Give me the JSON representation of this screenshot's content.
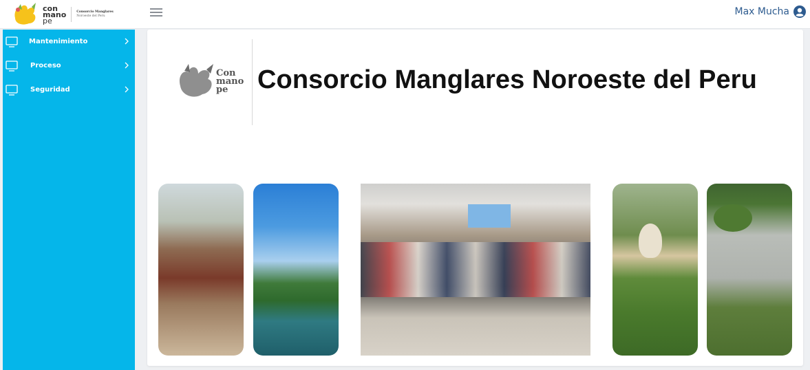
{
  "brand": {
    "logo_line1": "con",
    "logo_line2": "mano",
    "logo_line3": "pe",
    "sub_line1": "Consorcio Manglares",
    "sub_line2": "Noroeste del Peru"
  },
  "header": {
    "menu_icon": "hamburger-icon",
    "user_name": "Max Mucha",
    "user_icon": "user-circle-icon"
  },
  "sidebar": {
    "items": [
      {
        "label": "Mantenimiento",
        "icon": "monitor-icon"
      },
      {
        "label": "Proceso",
        "icon": "monitor-icon"
      },
      {
        "label": "Seguridad",
        "icon": "monitor-icon"
      }
    ]
  },
  "banner": {
    "logo_line1": "Con",
    "logo_line2": "mano",
    "logo_line3": "pe",
    "title": "Consorcio Manglares Noroeste del Peru"
  },
  "colors": {
    "sidebar_bg": "#05b6ea",
    "user_name": "#2d5b8f"
  }
}
